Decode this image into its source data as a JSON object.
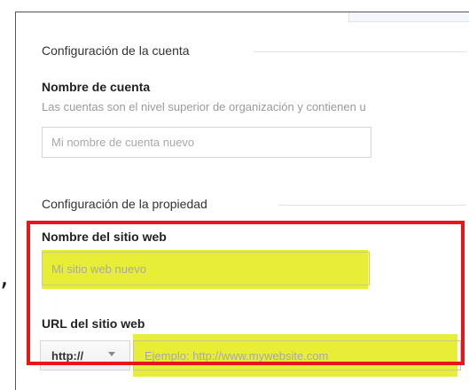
{
  "annotation": {
    "stray_glyph": ",",
    "highlight_color": "#e2e800",
    "frame_color": "#e8151b"
  },
  "account_section": {
    "title": "Configuración de la cuenta",
    "name_label": "Nombre de cuenta",
    "name_help": "Las cuentas son el nivel superior de organización y contienen u",
    "name_placeholder": "Mi nombre de cuenta nuevo"
  },
  "property_section": {
    "title": "Configuración de la propiedad",
    "site_name_label": "Nombre del sitio web",
    "site_name_placeholder": "Mi sitio web nuevo",
    "url_label": "URL del sitio web",
    "protocol_value": "http://",
    "protocol_icon": "caret-down-icon",
    "url_placeholder": "Ejemplo: http://www.mywebsite.com"
  }
}
